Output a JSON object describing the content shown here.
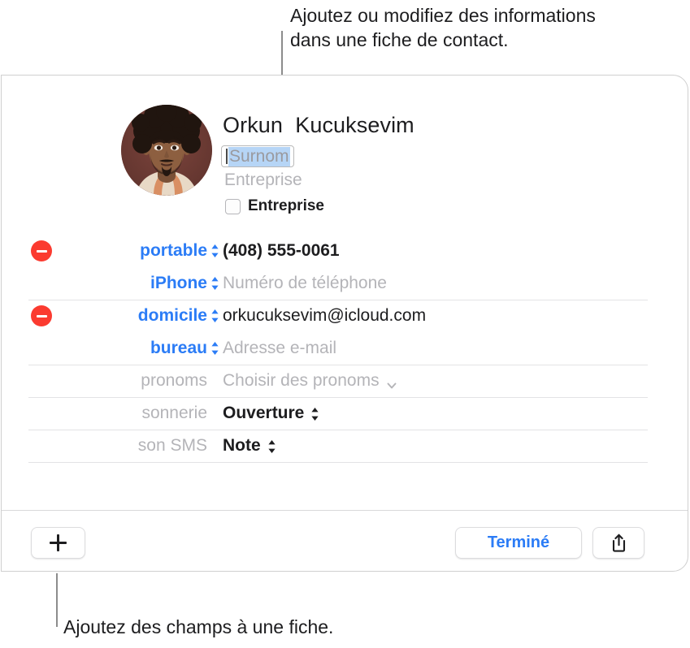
{
  "annotations": {
    "top_callout": "Ajoutez ou modifiez des informations\ndans une fiche de contact.",
    "bottom_callout": "Ajoutez des champs à une fiche."
  },
  "colors": {
    "accent_blue": "#2b7cf6",
    "delete_red": "#fb3b30",
    "placeholder_gray": "#b4b4b8",
    "selection_blue": "#b6d5f6",
    "card_border": "#cfcfcf",
    "separator": "#e3e3e5"
  },
  "card": {
    "header": {
      "avatar_name": "contact-photo",
      "first_name": "Orkun",
      "last_name": "Kucuksevim",
      "full_name": "Orkun  Kucuksevim",
      "nickname_placeholder": "Surnom",
      "nickname_value": "Surnom",
      "company_placeholder": "Entreprise",
      "company_toggle_label": "Entreprise",
      "company_toggle_checked": false
    },
    "fields": [
      {
        "removable": true,
        "label": "portable",
        "label_style": "link",
        "has_stepper": true,
        "value": "(408) 555-0061",
        "value_style": "bold",
        "separator_after": false
      },
      {
        "removable": false,
        "label": "iPhone",
        "label_style": "link",
        "has_stepper": true,
        "value": "Numéro de téléphone",
        "value_style": "placeholder",
        "separator_after": true
      },
      {
        "removable": true,
        "label": "domicile",
        "label_style": "link",
        "has_stepper": true,
        "value": "orkucuksevim@icloud.com",
        "value_style": "normal",
        "separator_after": false
      },
      {
        "removable": false,
        "label": "bureau",
        "label_style": "link",
        "has_stepper": true,
        "value": "Adresse e-mail",
        "value_style": "placeholder",
        "separator_after": true
      },
      {
        "removable": false,
        "label": "pronoms",
        "label_style": "muted",
        "has_stepper": false,
        "value": "Choisir des pronoms",
        "value_style": "placeholder",
        "value_chevron": true,
        "separator_after": true
      },
      {
        "removable": false,
        "label": "sonnerie",
        "label_style": "muted",
        "has_stepper": false,
        "value": "Ouverture",
        "value_style": "bold",
        "value_stepper": true,
        "separator_after": true
      },
      {
        "removable": false,
        "label": "son SMS",
        "label_style": "muted",
        "has_stepper": false,
        "value": "Note",
        "value_style": "bold",
        "value_stepper": true,
        "separator_after": true
      }
    ],
    "footer": {
      "add_field_icon": "plus-icon",
      "done_label": "Terminé",
      "share_icon": "share-icon"
    }
  }
}
